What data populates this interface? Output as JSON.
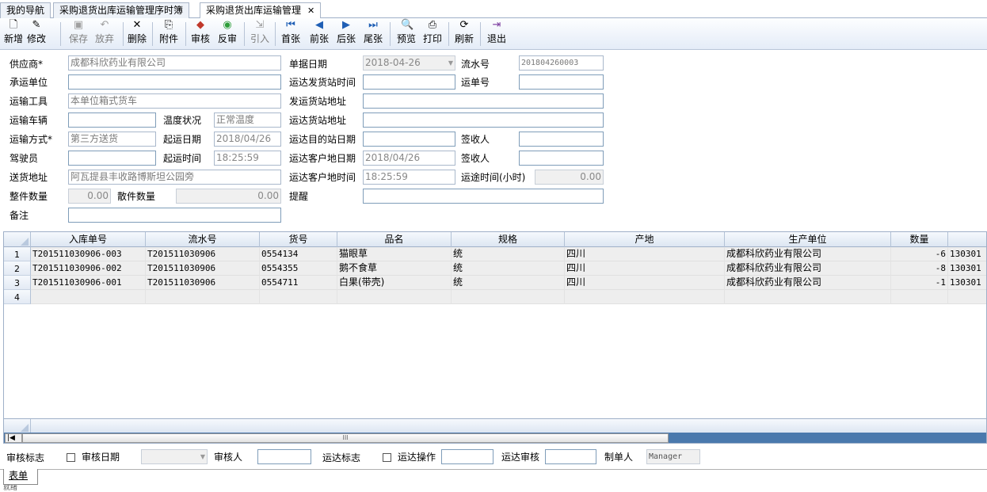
{
  "tabs": [
    {
      "label": "我的导航"
    },
    {
      "label": "采购退货出库运输管理序时簿"
    },
    {
      "label": "采购退货出库运输管理",
      "close": "✕"
    }
  ],
  "toolbar": {
    "buttons": [
      {
        "label": "新增",
        "icon": "new-doc-icon",
        "glyph": "🗋"
      },
      {
        "label": "修改",
        "icon": "edit-icon",
        "glyph": "✎"
      },
      {
        "label": "保存",
        "icon": "save-icon",
        "glyph": "▣"
      },
      {
        "label": "放弃",
        "icon": "undo-icon",
        "glyph": "↶"
      },
      {
        "label": "删除",
        "icon": "delete-icon",
        "glyph": "✕"
      },
      {
        "label": "附件",
        "icon": "attachment-icon",
        "glyph": "⎘"
      },
      {
        "label": "审核",
        "icon": "approve-icon",
        "glyph": "◆"
      },
      {
        "label": "反审",
        "icon": "unapprove-icon",
        "glyph": "◉"
      },
      {
        "label": "引入",
        "icon": "import-icon",
        "glyph": "⇲"
      },
      {
        "label": "首张",
        "icon": "first-record-icon",
        "glyph": "⏮"
      },
      {
        "label": "前张",
        "icon": "prev-record-icon",
        "glyph": "◀"
      },
      {
        "label": "后张",
        "icon": "next-record-icon",
        "glyph": "▶"
      },
      {
        "label": "尾张",
        "icon": "last-record-icon",
        "glyph": "⏭"
      },
      {
        "label": "预览",
        "icon": "preview-icon",
        "glyph": "🔍"
      },
      {
        "label": "打印",
        "icon": "print-icon",
        "glyph": "⎙"
      },
      {
        "label": "刷新",
        "icon": "refresh-icon",
        "glyph": "⟳"
      },
      {
        "label": "退出",
        "icon": "exit-icon",
        "glyph": "⇥"
      }
    ]
  },
  "form": {
    "supplier_label": "供应商*",
    "supplier": "成都科欣药业有限公司",
    "doc_date_label": "单据日期",
    "doc_date": "2018-04-26",
    "serial_label": "流水号",
    "serial": "201804260003",
    "carrier_label": "承运单位",
    "carrier": "",
    "dispatch_time_label": "运达发货站时间",
    "dispatch_time": "",
    "waybill_label": "运单号",
    "waybill": "",
    "vehicle_type_label": "运输工具",
    "vehicle_type": "本单位箱式货车",
    "dispatch_addr_label": "发运货站地址",
    "dispatch_addr": "",
    "vehicle_label": "运输车辆",
    "vehicle": "",
    "temp_label": "温度状况",
    "temp": "正常温度",
    "station_addr_label": "运达货站地址",
    "station_addr": "",
    "method_label": "运输方式*",
    "method": "第三方送货",
    "start_date_label": "起运日期",
    "start_date": "2018/04/26",
    "dest_date_label": "运达目的站日期",
    "dest_date": "",
    "receiver1_label": "签收人",
    "receiver1": "",
    "driver_label": "驾驶员",
    "driver": "",
    "start_time_label": "起运时间",
    "start_time": "18:25:59",
    "cust_date_label": "运达客户地日期",
    "cust_date": "2018/04/26",
    "receiver2_label": "签收人",
    "receiver2": "",
    "address_label": "送货地址",
    "address": "阿瓦提县丰收路博斯坦公园旁",
    "cust_time_label": "运达客户地时间",
    "cust_time": "18:25:59",
    "hours_label": "运途时间(小时)",
    "hours": "0.00",
    "whole_label": "整件数量",
    "whole": "0.00",
    "loose_label": "散件数量",
    "loose": "0.00",
    "remind_label": "提醒",
    "remind": "",
    "note_label": "备注",
    "note": ""
  },
  "grid": {
    "columns": [
      "入库单号",
      "流水号",
      "货号",
      "品名",
      "规格",
      "产地",
      "生产单位",
      "数量",
      ""
    ],
    "rows": [
      {
        "num": "1",
        "cells": [
          "T201511030906-003",
          "T201511030906",
          "0554134",
          "猫眼草",
          "统",
          "四川",
          "成都科欣药业有限公司",
          "-6",
          "130301"
        ]
      },
      {
        "num": "2",
        "cells": [
          "T201511030906-002",
          "T201511030906",
          "0554355",
          "鹅不食草",
          "统",
          "四川",
          "成都科欣药业有限公司",
          "-8",
          "130301"
        ]
      },
      {
        "num": "3",
        "cells": [
          "T201511030906-001",
          "T201511030906",
          "0554711",
          "白果(带壳)",
          "统",
          "四川",
          "成都科欣药业有限公司",
          "-1",
          "130301"
        ]
      },
      {
        "num": "4",
        "cells": [
          "",
          "",
          "",
          "",
          "",
          "",
          "",
          "",
          ""
        ]
      }
    ],
    "scroll_mark": "III"
  },
  "bottom": {
    "audit_flag_label": "审核标志",
    "audit_date_label": "审核日期",
    "audit_date": "",
    "auditor_label": "审核人",
    "auditor": "",
    "arrive_flag_label": "运达标志",
    "arrive_op_label": "运达操作",
    "arrive_op": "",
    "arrive_audit_label": "运达审核",
    "arrive_audit": "",
    "maker_label": "制单人",
    "maker": "Manager"
  },
  "bottom_tab": {
    "label": "表单"
  },
  "statusbar": {
    "text": "就绪"
  }
}
